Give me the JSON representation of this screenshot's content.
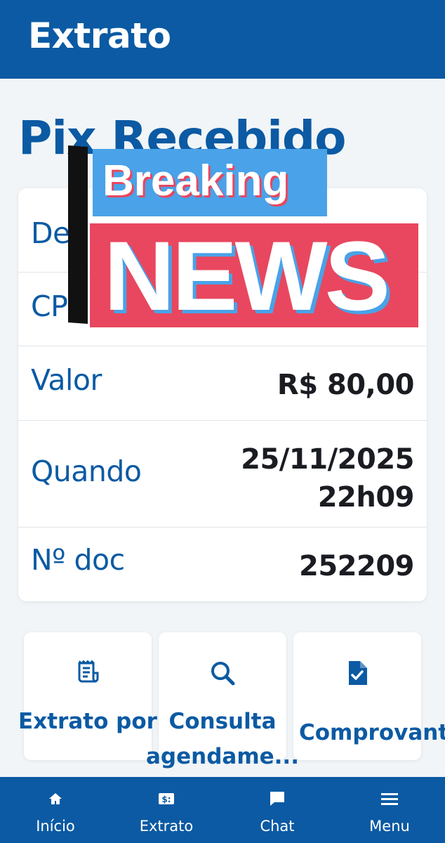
{
  "header": {
    "title": "Extrato"
  },
  "page": {
    "title": "Pix Recebido"
  },
  "details": [
    {
      "label": "De",
      "value": ""
    },
    {
      "label": "CPF",
      "value": ""
    },
    {
      "label": "Valor",
      "value": "R$ 80,00"
    },
    {
      "label": "Quando",
      "value_line1": "25/11/2025",
      "value_line2": "22h09"
    },
    {
      "label": "Nº doc",
      "value": "252209"
    }
  ],
  "actions": [
    {
      "icon": "receipt-icon",
      "label": "Extrato por"
    },
    {
      "icon": "search-icon",
      "label": "Consulta agendame..."
    },
    {
      "icon": "document-check-icon",
      "label": "Comprovant"
    }
  ],
  "tabbar": [
    {
      "icon": "home-icon",
      "label": "Início"
    },
    {
      "icon": "money-icon",
      "label": "Extrato"
    },
    {
      "icon": "chat-icon",
      "label": "Chat"
    },
    {
      "icon": "menu-icon",
      "label": "Menu"
    }
  ],
  "overlay": {
    "breaking": "Breaking",
    "news": "NEWS"
  },
  "colors": {
    "brand": "#0b5aa3",
    "news_red": "#e8475f",
    "news_blue": "#4aa2e8"
  }
}
